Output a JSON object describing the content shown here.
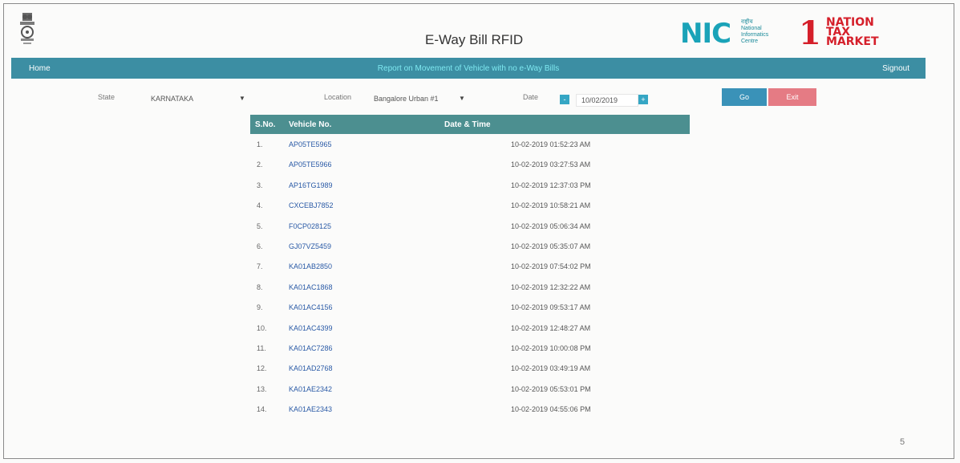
{
  "header": {
    "title": "E-Way Bill RFID",
    "nic_logo_text": "NIC",
    "nic_small_text": [
      "राष्ट्रीय",
      "National",
      "Informatics",
      "Centre"
    ],
    "ntm_logo_text": [
      "NATION",
      "TAX",
      "MARKET"
    ]
  },
  "navbar": {
    "home": "Home",
    "center": "Report on Movement of Vehicle with no e-Way Bills",
    "signout": "Signout"
  },
  "filters": {
    "state_label": "State",
    "state_value": "KARNATAKA",
    "location_label": "Location",
    "location_value": "Bangalore Urban #1",
    "date_label": "Date",
    "date_value": "10/02/2019",
    "date_prev": "-",
    "date_next": "+",
    "go_label": "Go",
    "exit_label": "Exit"
  },
  "table": {
    "headers": [
      "S.No.",
      "Vehicle No.",
      "Date & Time"
    ],
    "rows": [
      {
        "sn": "1.",
        "vehicle": "AP05TE5965",
        "datetime": "10-02-2019 01:52:23 AM"
      },
      {
        "sn": "2.",
        "vehicle": "AP05TE5966",
        "datetime": "10-02-2019 03:27:53 AM"
      },
      {
        "sn": "3.",
        "vehicle": "AP16TG1989",
        "datetime": "10-02-2019 12:37:03 PM"
      },
      {
        "sn": "4.",
        "vehicle": "CXCEBJ7852",
        "datetime": "10-02-2019 10:58:21 AM"
      },
      {
        "sn": "5.",
        "vehicle": "F0CP028125",
        "datetime": "10-02-2019 05:06:34 AM"
      },
      {
        "sn": "6.",
        "vehicle": "GJ07VZ5459",
        "datetime": "10-02-2019 05:35:07 AM"
      },
      {
        "sn": "7.",
        "vehicle": "KA01AB2850",
        "datetime": "10-02-2019 07:54:02 PM"
      },
      {
        "sn": "8.",
        "vehicle": "KA01AC1868",
        "datetime": "10-02-2019 12:32:22 AM"
      },
      {
        "sn": "9.",
        "vehicle": "KA01AC4156",
        "datetime": "10-02-2019 09:53:17 AM"
      },
      {
        "sn": "10.",
        "vehicle": "KA01AC4399",
        "datetime": "10-02-2019 12:48:27 AM"
      },
      {
        "sn": "11.",
        "vehicle": "KA01AC7286",
        "datetime": "10-02-2019 10:00:08 PM"
      },
      {
        "sn": "12.",
        "vehicle": "KA01AD2768",
        "datetime": "10-02-2019 03:49:19 AM"
      },
      {
        "sn": "13.",
        "vehicle": "KA01AE2342",
        "datetime": "10-02-2019 05:53:01 PM"
      },
      {
        "sn": "14.",
        "vehicle": "KA01AE2343",
        "datetime": "10-02-2019 04:55:06 PM"
      }
    ]
  },
  "page_number": "5",
  "colors": {
    "navbar": "#3c8ea3",
    "table_header": "#4c8f90",
    "go_button": "#3a92b8",
    "exit_button": "#e57b84",
    "vehicle_link": "#2a5aa6"
  },
  "icons": {
    "emblem": "national-emblem-icon",
    "dropdown": "caret-down-icon"
  }
}
